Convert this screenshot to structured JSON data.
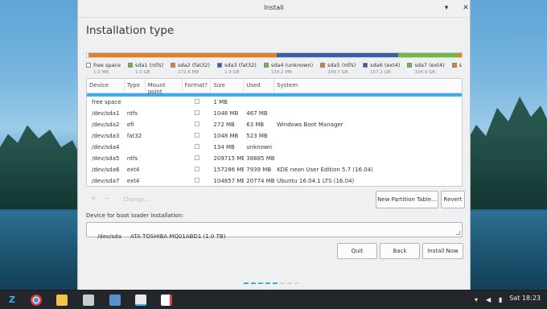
{
  "window": {
    "title": "Install",
    "minimize_glyph": "▾",
    "maximize_glyph": "▴",
    "close_glyph": "✕"
  },
  "page": {
    "heading": "Installation type"
  },
  "partition_bar": [
    {
      "name": "free space",
      "color": "#ffffff",
      "share": 0.5
    },
    {
      "name": "sda1 (ntfs)",
      "color": "#e67e22",
      "share": 0.6
    },
    {
      "name": "sda2 (fat32)",
      "color": "#e67e22",
      "share": 0.3
    },
    {
      "name": "sda3 (fat32)",
      "color": "#e67e22",
      "share": 0.6
    },
    {
      "name": "sda4 (unknown)",
      "color": "#e67e22",
      "share": 0.1
    },
    {
      "name": "sda5 (ntfs)",
      "color": "#e67e22",
      "share": 52.0
    },
    {
      "name": "sda6 (ext4)",
      "color": "#3c5ea8",
      "share": 34.5
    },
    {
      "name": "sda7 (ext4)",
      "color": "#6dbb3f",
      "share": 17.0
    },
    {
      "name": "extra",
      "color": "#e67e22",
      "share": 1.2
    }
  ],
  "legend": [
    {
      "label": "free space",
      "size": "1.0 MB",
      "color": "#ffffff"
    },
    {
      "label": "sda1 (ntfs)",
      "size": "1.0 GB",
      "color": "#6dbb3f"
    },
    {
      "label": "sda2 (fat32)",
      "size": "272.6 MB",
      "color": "#e67e22"
    },
    {
      "label": "sda3 (fat32)",
      "size": "1.0 GB",
      "color": "#3c5ea8"
    },
    {
      "label": "sda4 (unknown)",
      "size": "134.2 MB",
      "color": "#6dbb3f"
    },
    {
      "label": "sda5 (ntfs)",
      "size": "209.7 GB",
      "color": "#e67e22"
    },
    {
      "label": "sda6 (ext4)",
      "size": "157.2 GB",
      "color": "#3c5ea8"
    },
    {
      "label": "sda7 (ext4)",
      "size": "104.9 GB",
      "color": "#6dbb3f"
    },
    {
      "label": "s",
      "size": "",
      "color": "#e67e22"
    }
  ],
  "table": {
    "headers": [
      "Device",
      "Type",
      "Mount point",
      "Format?",
      "Size",
      "Used",
      "System"
    ],
    "rows": [
      {
        "device": "free space",
        "type": "",
        "mount": "",
        "size": "1 MB",
        "used": "",
        "system": ""
      },
      {
        "device": "/dev/sda1",
        "type": "ntfs",
        "mount": "",
        "size": "1048 MB",
        "used": "467 MB",
        "system": ""
      },
      {
        "device": "/dev/sda2",
        "type": "efi",
        "mount": "",
        "size": "272 MB",
        "used": "63 MB",
        "system": "Windows Boot Manager"
      },
      {
        "device": "/dev/sda3",
        "type": "fat32",
        "mount": "",
        "size": "1048 MB",
        "used": "523 MB",
        "system": ""
      },
      {
        "device": "/dev/sda4",
        "type": "",
        "mount": "",
        "size": "134 MB",
        "used": "unknown",
        "system": ""
      },
      {
        "device": "/dev/sda5",
        "type": "ntfs",
        "mount": "",
        "size": "209715 MB",
        "used": "38885 MB",
        "system": ""
      },
      {
        "device": "/dev/sda6",
        "type": "ext4",
        "mount": "",
        "size": "157286 MB",
        "used": "7939 MB",
        "system": "KDE neon User Edition 5.7 (16.04)"
      },
      {
        "device": "/dev/sda7",
        "type": "ext4",
        "mount": "",
        "size": "104857 MB",
        "used": "20774 MB",
        "system": "Ubuntu 16.04.1 LTS (16.04)"
      }
    ]
  },
  "toolbar": {
    "plus": "+",
    "minus": "−",
    "change": "Change...",
    "new_partition_table": "New Partition Table...",
    "revert": "Revert"
  },
  "boot_loader": {
    "label": "Device for boot loader installation:",
    "device": "/dev/sda",
    "description": "ATA TOSHIBA MQ01ABD1 (1.0 TB)"
  },
  "buttons": {
    "quit": "Quit",
    "back": "Back",
    "install_now": "Install Now"
  },
  "progress_dots": {
    "total": 8,
    "active": 5
  },
  "taskbar": {
    "clock": "Sat 18:23",
    "icons": [
      "zorin-menu-icon",
      "chrome-icon",
      "files-icon",
      "folder-icon",
      "software-icon",
      "installer-icon",
      "document-icon"
    ]
  }
}
